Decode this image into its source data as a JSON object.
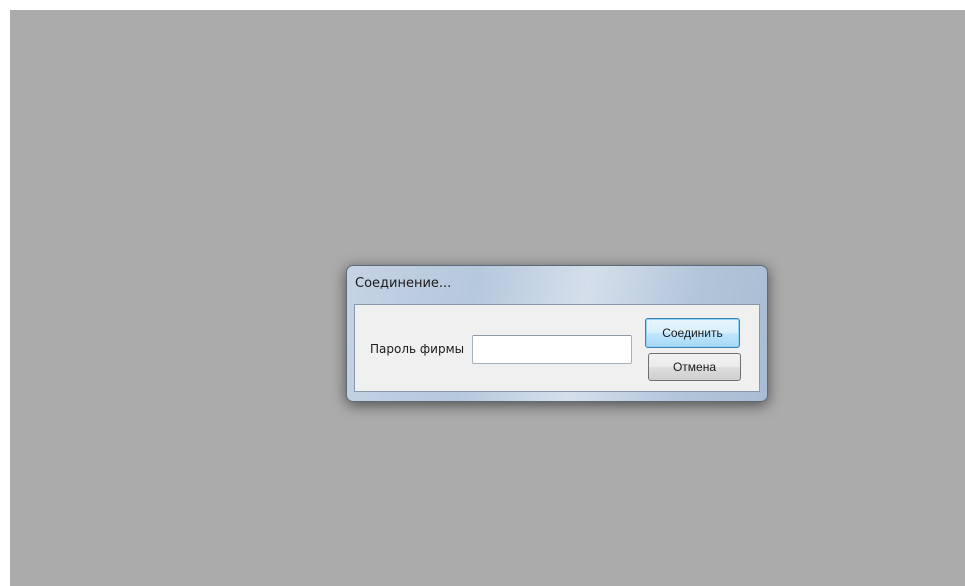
{
  "dialog": {
    "title": "Соединение...",
    "password_label": "Пароль фирмы",
    "password_value": "",
    "connect_label": "Соединить",
    "cancel_label": "Отмена"
  },
  "colors": {
    "desktop": "#ababab",
    "client_area": "#f0f0f0",
    "default_button_border": "#3c7fb1"
  }
}
